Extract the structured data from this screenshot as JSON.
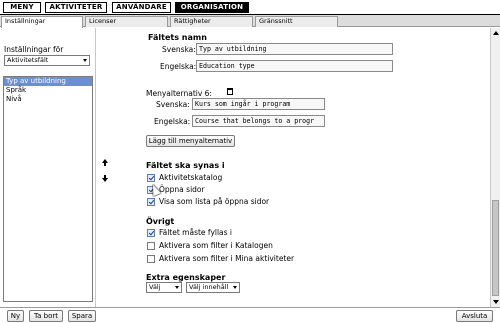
{
  "nav": {
    "items": [
      {
        "label": "MENY"
      },
      {
        "label": "AKTIVITETER"
      },
      {
        "label": "ANVÄNDARE"
      },
      {
        "label": "ORGANISATION"
      }
    ]
  },
  "tabs": [
    {
      "label": "Inställningar"
    },
    {
      "label": "Licenser"
    },
    {
      "label": "Rättigheter"
    },
    {
      "label": "Gränssnitt"
    }
  ],
  "left": {
    "settings_label": "Inställningar för",
    "settings_value": "Aktivitetsfält",
    "list": [
      "Typ av utbildning",
      "Språk",
      "Nivå"
    ]
  },
  "main": {
    "field_name_heading": "Fältets namn",
    "swedish_label": "Svenska:",
    "swedish_value": "Typ av utbildning",
    "english_label": "Engelska:",
    "english_value": "Education type",
    "menu_alt_label": "Menyalternativ 6:",
    "menu_sv_label": "Svenska:",
    "menu_sv_value": "Kurs som ingår i program",
    "menu_en_label": "Engelska:",
    "menu_en_value": "Course that belongs to a progr",
    "add_menu_alt_button": "Lägg till menyalternativ",
    "visible_heading": "Fältet ska synas i",
    "visible_options": [
      {
        "label": "Aktivitetskatalog",
        "checked": true
      },
      {
        "label": "Öppna sidor",
        "checked": true
      },
      {
        "label": "Visa som lista på öppna sidor",
        "checked": true
      }
    ],
    "other_heading": "Övrigt",
    "other_options": [
      {
        "label": "Fältet måste fyllas i",
        "checked": true
      },
      {
        "label": "Aktivera som filter i Katalogen",
        "checked": false
      },
      {
        "label": "Aktivera som filter i Mina aktiviteter",
        "checked": false
      }
    ],
    "extra_heading": "Extra egenskaper",
    "extra_select1": "Välj",
    "extra_select2": "Välj innehåll"
  },
  "bottom": {
    "new_button": "Ny",
    "delete_button": "Ta bort",
    "save_button": "Spara",
    "quit_button": "Avsluta"
  }
}
